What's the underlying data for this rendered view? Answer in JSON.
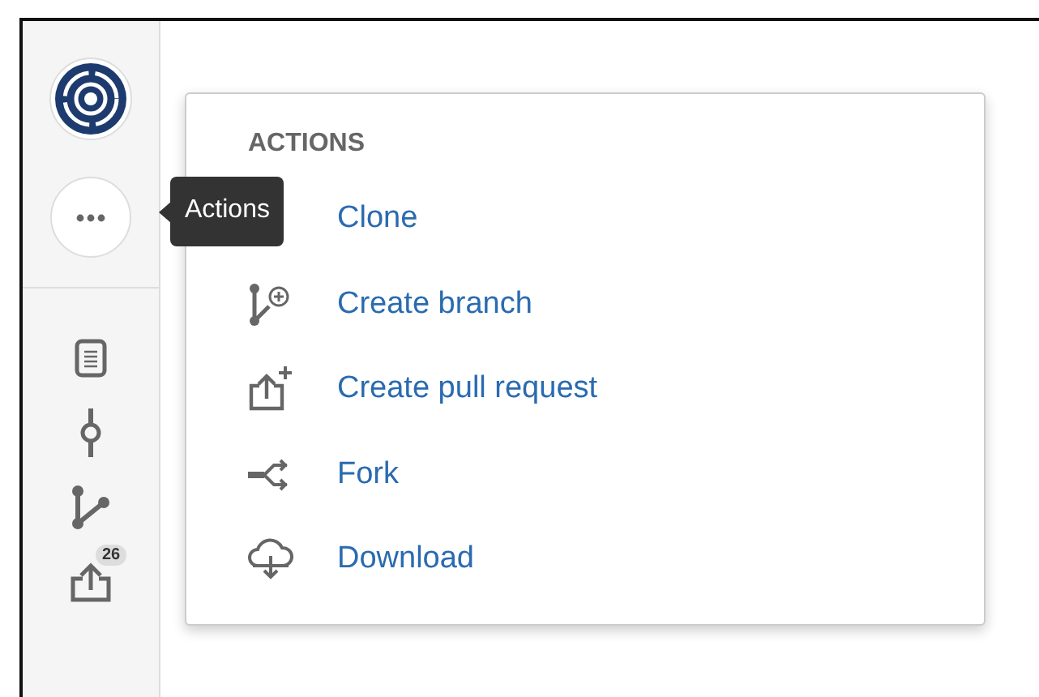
{
  "sidebar": {
    "items": [
      {
        "kind": "source"
      },
      {
        "kind": "commits"
      },
      {
        "kind": "branches"
      },
      {
        "kind": "pull-requests",
        "badge": "26"
      }
    ]
  },
  "tooltip": {
    "text": "Actions"
  },
  "menu": {
    "heading": "ACTIONS",
    "items": [
      {
        "kind": "clone",
        "label": "Clone"
      },
      {
        "kind": "branch",
        "label": "Create branch"
      },
      {
        "kind": "pull-request",
        "label": "Create pull request"
      },
      {
        "kind": "fork",
        "label": "Fork"
      },
      {
        "kind": "download",
        "label": "Download"
      }
    ]
  }
}
